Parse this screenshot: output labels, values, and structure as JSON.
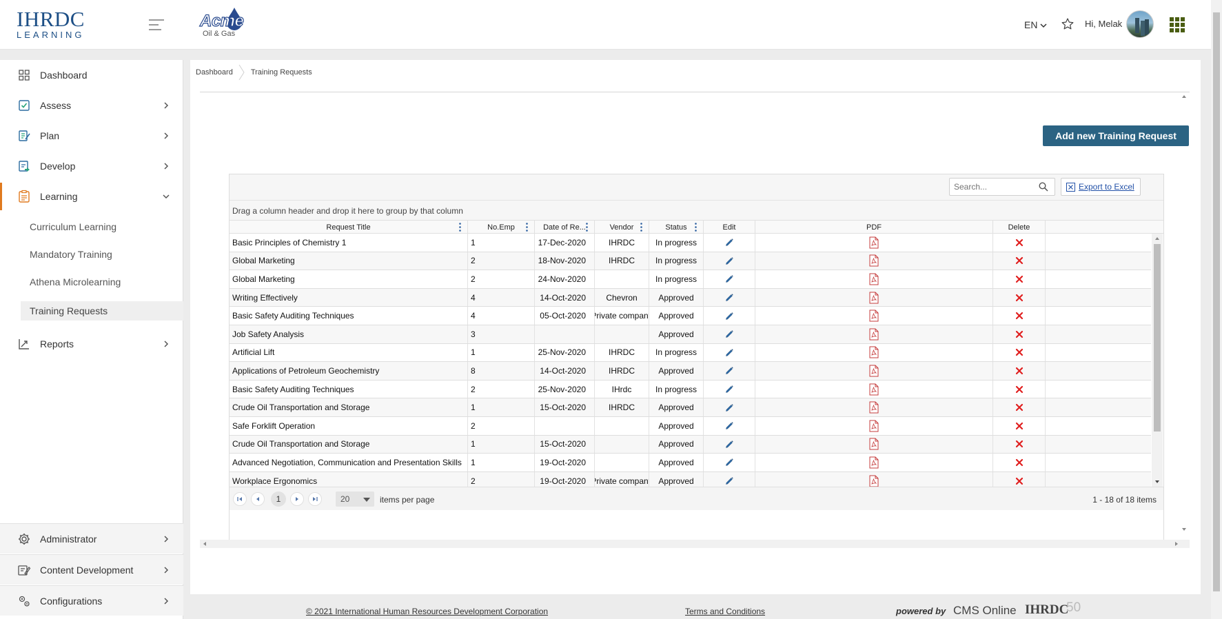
{
  "header": {
    "logo_main": "IHRDC",
    "logo_sub": "LEARNING",
    "client_logo_word": "Acme",
    "client_logo_sub": "Oil & Gas",
    "language": "EN",
    "greeting": "Hi, Melak",
    "icons": [
      "menu-icon",
      "star-icon",
      "avatar",
      "apps-grid-icon"
    ]
  },
  "sidebar": {
    "items": [
      {
        "label": "Dashboard",
        "icon": "dashboard-icon",
        "has_children": false
      },
      {
        "label": "Assess",
        "icon": "assess-icon",
        "has_children": true
      },
      {
        "label": "Plan",
        "icon": "plan-icon",
        "has_children": true
      },
      {
        "label": "Develop",
        "icon": "develop-icon",
        "has_children": true
      },
      {
        "label": "Learning",
        "icon": "learning-icon",
        "has_children": true,
        "expanded": true
      }
    ],
    "learning_children": [
      {
        "label": "Curriculum Learning"
      },
      {
        "label": "Mandatory Training"
      },
      {
        "label": "Athena Microlearning"
      },
      {
        "label": "Training Requests",
        "selected": true
      }
    ],
    "reports": {
      "label": "Reports",
      "icon": "reports-icon"
    },
    "bottom_items": [
      {
        "label": "Administrator",
        "icon": "gear-icon"
      },
      {
        "label": "Content Development",
        "icon": "content-development-icon"
      },
      {
        "label": "Configurations",
        "icon": "configurations-icon"
      }
    ],
    "accent_color": "#e07a1f"
  },
  "breadcrumb": {
    "home": "Dashboard",
    "current": "Training Requests"
  },
  "actions": {
    "add_label": "Add new Training Request",
    "add_color": "#2b6383"
  },
  "grid": {
    "search_placeholder": "Search...",
    "export_label": "Export to Excel",
    "group_hint": "Drag a column header and drop it here to group by that column",
    "columns": [
      "Request Title",
      "No.Emp",
      "Date of Re...",
      "Vendor",
      "Status",
      "Edit",
      "PDF",
      "Delete"
    ],
    "rows": [
      {
        "title": "Basic Principles of Chemistry 1",
        "emp": "1",
        "date": "17-Dec-2020",
        "vendor": "IHRDC",
        "status": "In progress"
      },
      {
        "title": "Global Marketing",
        "emp": "2",
        "date": "18-Nov-2020",
        "vendor": "IHRDC",
        "status": "In progress"
      },
      {
        "title": "Global Marketing",
        "emp": "2",
        "date": "24-Nov-2020",
        "vendor": "",
        "status": "In progress"
      },
      {
        "title": "Writing Effectively",
        "emp": "4",
        "date": "14-Oct-2020",
        "vendor": "Chevron",
        "status": "Approved"
      },
      {
        "title": "Basic Safety Auditing Techniques",
        "emp": "4",
        "date": "05-Oct-2020",
        "vendor": "Private company",
        "status": "Approved"
      },
      {
        "title": "Job Safety Analysis",
        "emp": "3",
        "date": "",
        "vendor": "",
        "status": "Approved"
      },
      {
        "title": "Artificial Lift",
        "emp": "1",
        "date": "25-Nov-2020",
        "vendor": "IHRDC",
        "status": "In progress"
      },
      {
        "title": "Applications of Petroleum Geochemistry",
        "emp": "8",
        "date": "14-Oct-2020",
        "vendor": "IHRDC",
        "status": "Approved"
      },
      {
        "title": "Basic Safety Auditing Techniques",
        "emp": "2",
        "date": "25-Nov-2020",
        "vendor": "IHrdc",
        "status": "In progress"
      },
      {
        "title": "Crude Oil Transportation and Storage",
        "emp": "1",
        "date": "15-Oct-2020",
        "vendor": "IHRDC",
        "status": "Approved"
      },
      {
        "title": "Safe Forklift Operation",
        "emp": "2",
        "date": "",
        "vendor": "",
        "status": "Approved"
      },
      {
        "title": "Crude Oil Transportation and Storage",
        "emp": "1",
        "date": "15-Oct-2020",
        "vendor": "",
        "status": "Approved"
      },
      {
        "title": "Advanced Negotiation, Communication and Presentation Skills",
        "emp": "1",
        "date": "19-Oct-2020",
        "vendor": "",
        "status": "Approved"
      },
      {
        "title": "Workplace Ergonomics",
        "emp": "2",
        "date": "19-Oct-2020",
        "vendor": "Private company",
        "status": "Approved"
      }
    ],
    "row_icons": {
      "edit": "pencil-icon",
      "pdf": "pdf-icon",
      "delete": "delete-x-icon"
    },
    "pager": {
      "page": "1",
      "page_size": "20",
      "per_page_label": "items per page",
      "info": "1 - 18 of 18 items"
    }
  },
  "footer": {
    "copyright": "© 2021 International Human Resources Development Corporation",
    "terms": "Terms and Conditions",
    "powered": "powered by",
    "cms": "CMS Online",
    "brand": "IHRDC",
    "anniversary": "50"
  }
}
